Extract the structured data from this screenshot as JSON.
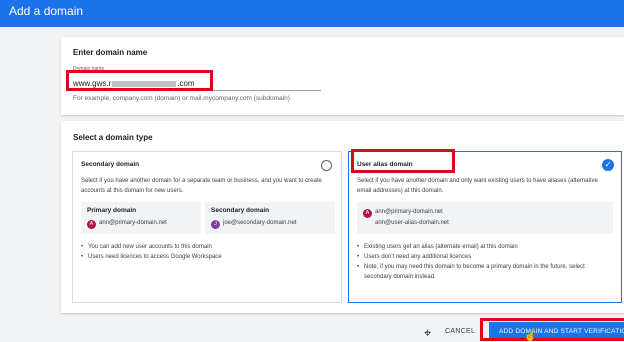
{
  "header": {
    "title": "Add a domain"
  },
  "domain_name": {
    "heading": "Enter domain name",
    "field_label": "Domain name",
    "value_prefix": "www.gws.r",
    "value_suffix": ".com",
    "hint": "For example, company.com (domain) or mail.mycompany.com (subdomain)"
  },
  "domain_type": {
    "heading": "Select a domain type",
    "secondary": {
      "title": "Secondary domain",
      "description": "Select if you have another domain for a separate team or business, and you want to create accounts at this domain for new users.",
      "primary_label": "Primary domain",
      "primary_avatar": "A",
      "primary_email": "ann@primary-domain.net",
      "secondary_label": "Secondary domain",
      "secondary_avatar": "J",
      "secondary_email": "joe@secondary-domain.net",
      "bullets": [
        "You can add new user accounts to this domain",
        "Users need licences to access Google Workspace"
      ]
    },
    "alias": {
      "title": "User alias domain",
      "description": "Select if you have another domain and only want existing users to have aliases (alternative email addresses) at this domain.",
      "avatar": "A",
      "email1": "ann@primary-domain.net",
      "email2": "ann@user-alias-domain.net",
      "bullets": [
        "Existing users get an alias (alternate email) at this domain",
        "Users don't need any additional licences",
        "Note, if you may need this domain to become a primary domain in the future, select secondary domain instead."
      ]
    }
  },
  "actions": {
    "cancel": "CANCEL",
    "submit": "ADD DOMAIN AND START VERIFICATION"
  },
  "colors": {
    "accent": "#1a73e8",
    "highlight": "#e0051b",
    "avatar_a": "#b3124e",
    "avatar_j": "#7b3fa0"
  }
}
